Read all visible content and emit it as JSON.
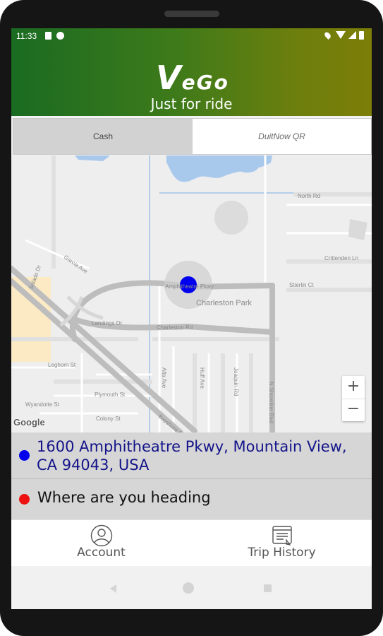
{
  "status_bar": {
    "time": "11:33"
  },
  "header": {
    "logo_initial": "V",
    "logo_rest": "eGo",
    "tagline": "Just for ride",
    "gradient_start": "#1a6b22",
    "gradient_end": "#7c7e07"
  },
  "payment_tabs": [
    {
      "label": "Cash",
      "selected": true
    },
    {
      "label": "DuitNow QR",
      "selected": false
    }
  ],
  "map": {
    "attribution": "Google",
    "zoom_in": "+",
    "zoom_out": "−",
    "labels": {
      "north_rd": "North Rd",
      "crittenden": "Crittenden Ln",
      "amphitheatre": "Amphitheatre Pkwy",
      "stierlin": "Stierlin Ct",
      "charleston_park": "Charleston Park",
      "garcia": "Garcia Ave",
      "landings": "Landings Dr",
      "charleston_rd": "Charleston Rd",
      "leghorn": "Leghorn St",
      "alta": "Alta Ave",
      "huff": "Huff Ave",
      "joaquin": "Joaquin Rd",
      "shoreline": "N Shoreline Blvd",
      "plymouth": "Plymouth St",
      "wyandotte": "Wyandotte St",
      "colony": "Colony St",
      "bayshore": "Bayshore Fwy",
      "salado": "Salado Dr"
    },
    "marker_color": "#0000ee"
  },
  "pickup": {
    "address": "1600 Amphitheatre Pkwy, Mountain View, CA 94043, USA",
    "dot_color": "#0000ee"
  },
  "destination": {
    "placeholder": "Where are you heading",
    "dot_color": "#ee1111"
  },
  "bottom_nav": [
    {
      "label": "Account",
      "icon": "account-icon"
    },
    {
      "label": "Trip History",
      "icon": "trip-history-icon"
    }
  ]
}
